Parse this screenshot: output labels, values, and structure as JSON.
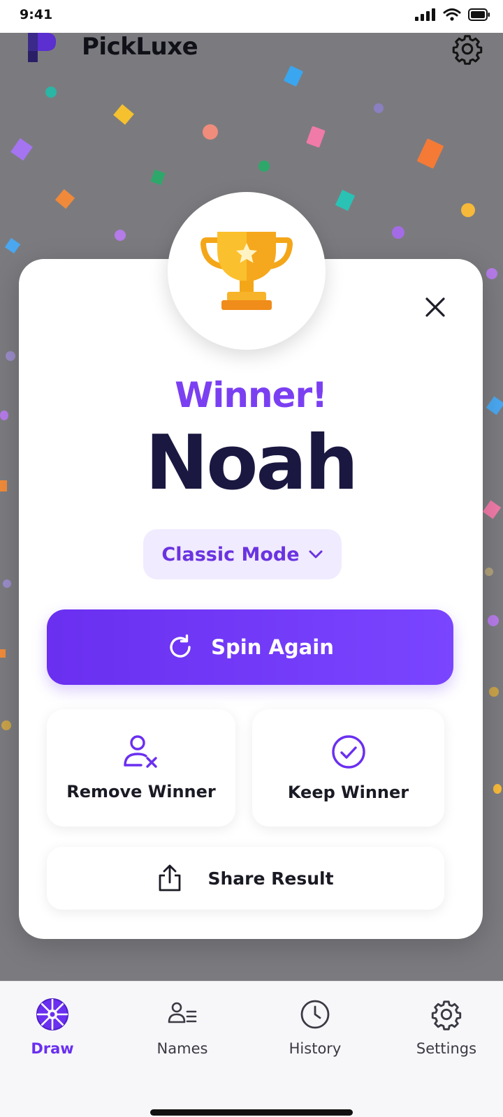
{
  "status_bar": {
    "time": "9:41",
    "icons": [
      "signal-icon",
      "wifi-icon",
      "battery-icon"
    ]
  },
  "app": {
    "title": "PickLuxe",
    "logo_icon": "pickluxe-logo",
    "settings_icon": "gear-icon"
  },
  "modal": {
    "trophy_icon": "trophy-icon",
    "close_icon": "close-icon",
    "winner_label": "Winner!",
    "winner_name": "Noah",
    "mode": {
      "label": "Classic Mode",
      "icon": "chevron-down-icon"
    },
    "spin_again": {
      "label": "Spin Again",
      "icon": "refresh-icon"
    },
    "remove_winner": {
      "label": "Remove Winner",
      "icon": "remove-user-icon"
    },
    "keep_winner": {
      "label": "Keep Winner",
      "icon": "check-circle-icon"
    },
    "share": {
      "label": "Share Result",
      "icon": "share-icon"
    }
  },
  "bottom_nav": {
    "items": [
      {
        "label": "Draw",
        "icon": "wheel-icon",
        "active": true
      },
      {
        "label": "Names",
        "icon": "names-list-icon",
        "active": false
      },
      {
        "label": "History",
        "icon": "clock-icon",
        "active": false
      },
      {
        "label": "Settings",
        "icon": "gear-icon",
        "active": false
      }
    ]
  },
  "colors": {
    "accent": "#6a2ff0",
    "winner_label": "#7b3ff2",
    "winner_name": "#1a1840",
    "overlay": "#7b7b7f",
    "trophy": "#f9b320"
  }
}
